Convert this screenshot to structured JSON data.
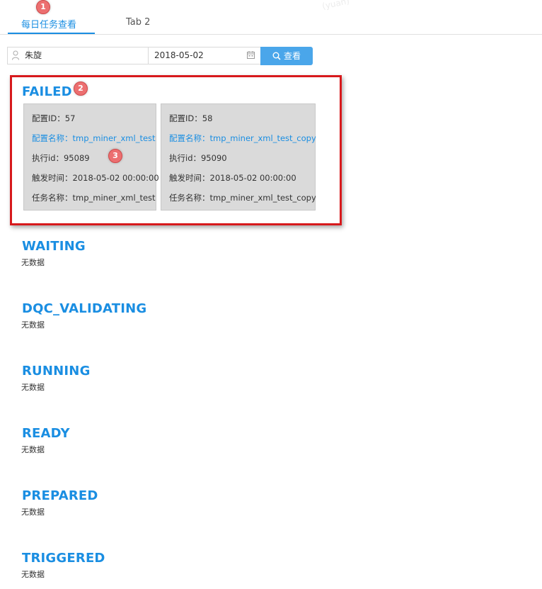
{
  "tabs": [
    {
      "label": "每日任务查看",
      "active": true
    },
    {
      "label": "Tab 2",
      "active": false
    }
  ],
  "markers": [
    "1",
    "2",
    "3"
  ],
  "watermark": "(yuan)",
  "search": {
    "user_value": "朱旋",
    "date_value": "2018-05-02",
    "button_label": "查看"
  },
  "sections": [
    {
      "title": "FAILED",
      "cards": [
        {
          "config_id": "配置ID：57",
          "config_name": "配置名称：tmp_miner_xml_test",
          "exec_id": "执行id：95089",
          "trigger_time": "触发时间：2018-05-02 00:00:00",
          "task_name": "任务名称：tmp_miner_xml_test"
        },
        {
          "config_id": "配置ID：58",
          "config_name": "配置名称：tmp_miner_xml_test_copy",
          "exec_id": "执行id：95090",
          "trigger_time": "触发时间：2018-05-02 00:00:00",
          "task_name": "任务名称：tmp_miner_xml_test_copy"
        }
      ]
    },
    {
      "title": "WAITING",
      "empty_text": "无数据"
    },
    {
      "title": "DQC_VALIDATING",
      "empty_text": "无数据"
    },
    {
      "title": "RUNNING",
      "empty_text": "无数据"
    },
    {
      "title": "READY",
      "empty_text": "无数据"
    },
    {
      "title": "PREPARED",
      "empty_text": "无数据"
    },
    {
      "title": "TRIGGERED",
      "empty_text": "无数据"
    }
  ],
  "colors": {
    "accent": "#1a8ee2",
    "button": "#4aa6ea",
    "highlight": "#d7191c",
    "marker": "#ec6f70",
    "card_bg": "#dadada"
  }
}
